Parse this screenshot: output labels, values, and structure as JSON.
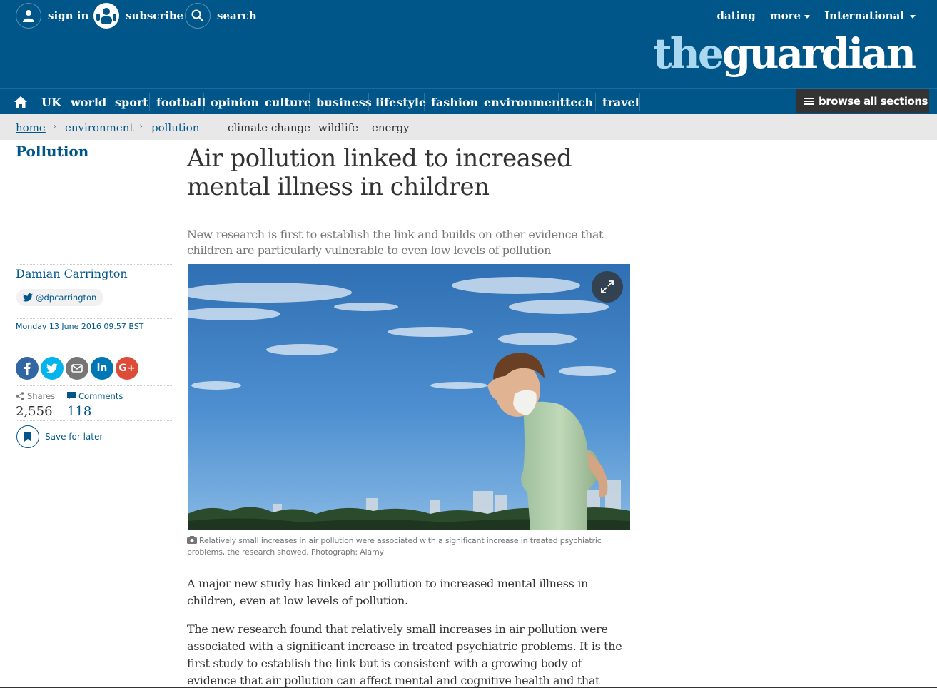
{
  "header": {
    "sign_in": "sign in",
    "subscribe": "subscribe",
    "search": "search",
    "dating": "dating",
    "more": "more",
    "edition": "International",
    "logo_the": "the",
    "logo_guardian": "guardian"
  },
  "nav": {
    "items": [
      "UK",
      "world",
      "sport",
      "football",
      "opinion",
      "culture",
      "business",
      "lifestyle",
      "fashion",
      "environment",
      "tech",
      "travel"
    ],
    "browse": "browse all sections"
  },
  "breadcrumb": {
    "home": "home",
    "environment": "environment",
    "pollution": "pollution",
    "keywords": [
      "climate change",
      "wildlife",
      "energy"
    ]
  },
  "article": {
    "section": "Pollution",
    "headline": "Air pollution linked to increased mental illness in children",
    "standfirst": "New research is first to establish the link and builds on other evidence that children are particularly vulnerable to even low levels of pollution",
    "author": "Damian Carrington",
    "twitter": "@dpcarrington",
    "date": "Monday 13 June 2016 09.57 BST",
    "shares_label": "Shares",
    "shares_count": "2,556",
    "comments_label": "Comments",
    "comments_count": "118",
    "save_label": "Save for later",
    "caption": "Relatively small increases in air pollution were associated with a significant increase in treated psychiatric problems, the research showed. Photograph: Alamy",
    "paragraphs": [
      "A major new study has linked air pollution to increased mental illness in children, even at low levels of pollution.",
      "The new research found that relatively small increases in air pollution were associated with a significant increase in treated psychiatric problems. It is the first study to establish the link but is consistent with a growing body of evidence that air pollution can affect mental and cognitive health and that children are"
    ]
  },
  "share_buttons": [
    {
      "icon": "facebook-icon",
      "glyph": "f",
      "color": "#3067a3"
    },
    {
      "icon": "twitter-icon",
      "glyph": "",
      "color": "#03b3ee"
    },
    {
      "icon": "email-icon",
      "glyph": "",
      "color": "#767676"
    },
    {
      "icon": "linkedin-icon",
      "glyph": "in",
      "color": "#0077b5"
    },
    {
      "icon": "google-plus-icon",
      "glyph": "G+",
      "color": "#dd4b39"
    }
  ],
  "colors": {
    "brand": "#005689",
    "logo_the": "#aad8f1",
    "breadcrumb_bg": "#e8e8e8"
  }
}
